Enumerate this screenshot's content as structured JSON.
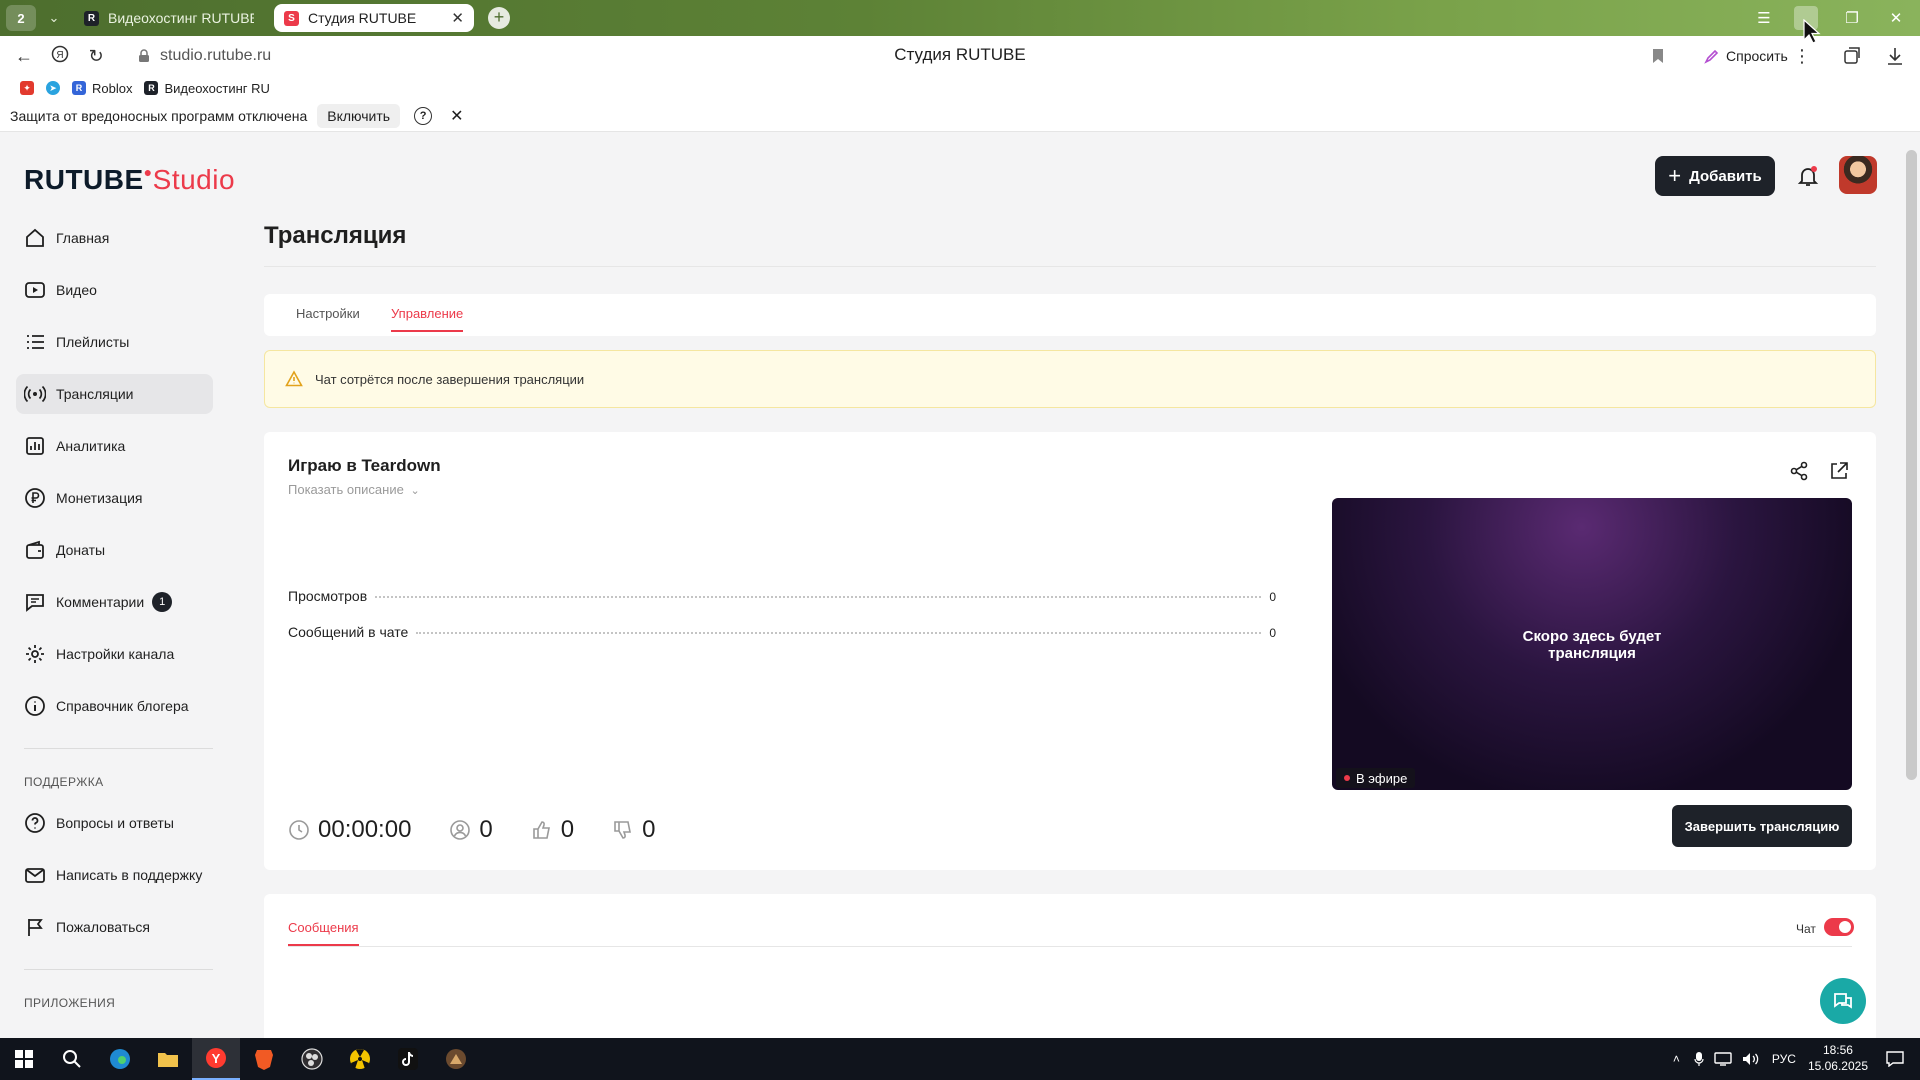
{
  "browser": {
    "tab_count": "2",
    "tabs": [
      {
        "label": "Видеохостинг RUTUBE. С"
      },
      {
        "label": "Студия RUTUBE"
      }
    ],
    "url": "studio.rutube.ru",
    "page_title": "Студия RUTUBE",
    "ask_label": "Спросить",
    "bookmarks": [
      {
        "label": "Roblox"
      },
      {
        "label": "Видеохостинг RU"
      }
    ],
    "infobar": {
      "message": "Защита от вредоносных программ отключена",
      "enable_label": "Включить",
      "help": "?"
    }
  },
  "app": {
    "logo_main": "RUTUBE",
    "logo_studio": "Studio",
    "add_label": "Добавить",
    "nav": [
      {
        "label": "Главная"
      },
      {
        "label": "Видео"
      },
      {
        "label": "Плейлисты"
      },
      {
        "label": "Трансляции"
      },
      {
        "label": "Аналитика"
      },
      {
        "label": "Монетизация"
      },
      {
        "label": "Донаты"
      },
      {
        "label": "Комментарии",
        "badge": "1"
      },
      {
        "label": "Настройки канала"
      },
      {
        "label": "Справочник блогера"
      }
    ],
    "support_section": "ПОДДЕРЖКА",
    "support": [
      {
        "label": "Вопросы и ответы"
      },
      {
        "label": "Написать в поддержку"
      },
      {
        "label": "Пожаловаться"
      }
    ],
    "apps_section": "ПРИЛОЖЕНИЯ"
  },
  "page": {
    "title": "Трансляция",
    "tabs": [
      {
        "label": "Настройки"
      },
      {
        "label": "Управление"
      }
    ],
    "warning": "Чат сотрётся после завершения трансляции",
    "stream": {
      "title": "Играю в Teardown",
      "show_description": "Показать описание",
      "stats": [
        {
          "label": "Просмотров",
          "value": "0"
        },
        {
          "label": "Сообщений в чате",
          "value": "0"
        }
      ],
      "duration": "00:00:00",
      "viewers": "0",
      "likes": "0",
      "dislikes": "0",
      "player_text_line1": "Скоро здесь будет",
      "player_text_line2": "трансляция",
      "live_label": "В эфире",
      "end_label": "Завершить трансляцию"
    },
    "messages": {
      "tab_label": "Сообщения",
      "chat_label": "Чат"
    }
  },
  "taskbar": {
    "lang": "РУС",
    "time": "18:56",
    "date": "15.06.2025"
  },
  "colors": {
    "accent": "#ec3a4a",
    "dark_button": "#1e2229",
    "warning_bg": "#fffbe6",
    "help_fab": "#1aa9a6"
  }
}
